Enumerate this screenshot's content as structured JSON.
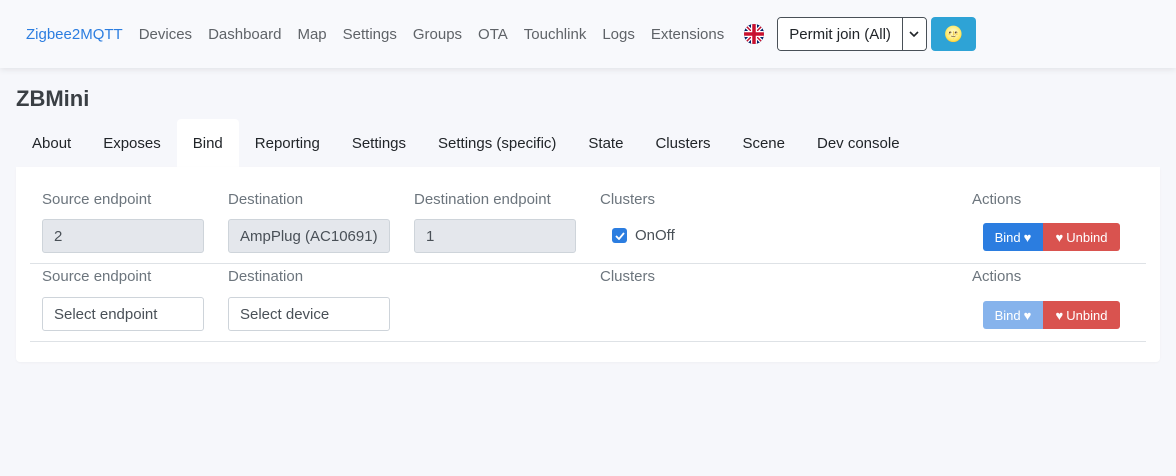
{
  "nav": {
    "brand": "Zigbee2MQTT",
    "links": [
      "Devices",
      "Dashboard",
      "Map",
      "Settings",
      "Groups",
      "OTA",
      "Touchlink",
      "Logs",
      "Extensions"
    ],
    "permit_join": "Permit join (All)",
    "theme_icon": "🌝"
  },
  "page": {
    "title": "ZBMini"
  },
  "tabs": [
    "About",
    "Exposes",
    "Bind",
    "Reporting",
    "Settings",
    "Settings (specific)",
    "State",
    "Clusters",
    "Scene",
    "Dev console"
  ],
  "active_tab": "Bind",
  "bind_rows": [
    {
      "source_label": "Source endpoint",
      "source_value": "2",
      "destination_label": "Destination",
      "destination_value": "AmpPlug (AC10691)",
      "dest_endpoint_label": "Destination endpoint",
      "dest_endpoint_value": "1",
      "clusters_label": "Clusters",
      "cluster": "OnOff",
      "cluster_checked": true,
      "actions_label": "Actions",
      "bind_label": "Bind",
      "unbind_label": "Unbind"
    },
    {
      "source_label": "Source endpoint",
      "source_placeholder": "Select endpoint",
      "destination_label": "Destination",
      "destination_placeholder": "Select device",
      "clusters_label": "Clusters",
      "actions_label": "Actions",
      "bind_label": "Bind",
      "unbind_label": "Unbind"
    }
  ],
  "colors": {
    "accent": "#2b7de0",
    "danger": "#d9534f",
    "theme_button": "#2ea3d6"
  }
}
